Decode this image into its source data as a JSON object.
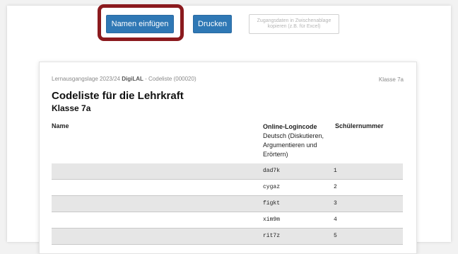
{
  "toolbar": {
    "insert_names_label": "Namen einfügen",
    "print_label": "Drucken",
    "copy_credentials_label": "Zugangsdaten in Zwischenablage\nkopieren (z.B. für Excel)"
  },
  "sheet": {
    "meta_prefix": "Lernausgangslage 2023/24",
    "meta_brand": "DigiLAL",
    "meta_suffix": "- Codeliste (000020)",
    "class_label": "Klasse 7a",
    "title": "Codeliste für die Lehrkraft",
    "subtitle": "Klasse 7a",
    "headers": {
      "name": "Name",
      "code_title": "Online-Logincode",
      "code_sub": "Deutsch (Diskutieren, Argumentieren und Erörtern)",
      "number": "Schülernummer"
    },
    "rows": [
      {
        "name": "",
        "code": "dad7k",
        "number": "1"
      },
      {
        "name": "",
        "code": "cygaz",
        "number": "2"
      },
      {
        "name": "",
        "code": "figkt",
        "number": "3"
      },
      {
        "name": "",
        "code": "xim9m",
        "number": "4"
      },
      {
        "name": "",
        "code": "rit7z",
        "number": "5"
      }
    ]
  },
  "colors": {
    "primary": "#2f78b5",
    "highlight": "#8b1a1e"
  }
}
